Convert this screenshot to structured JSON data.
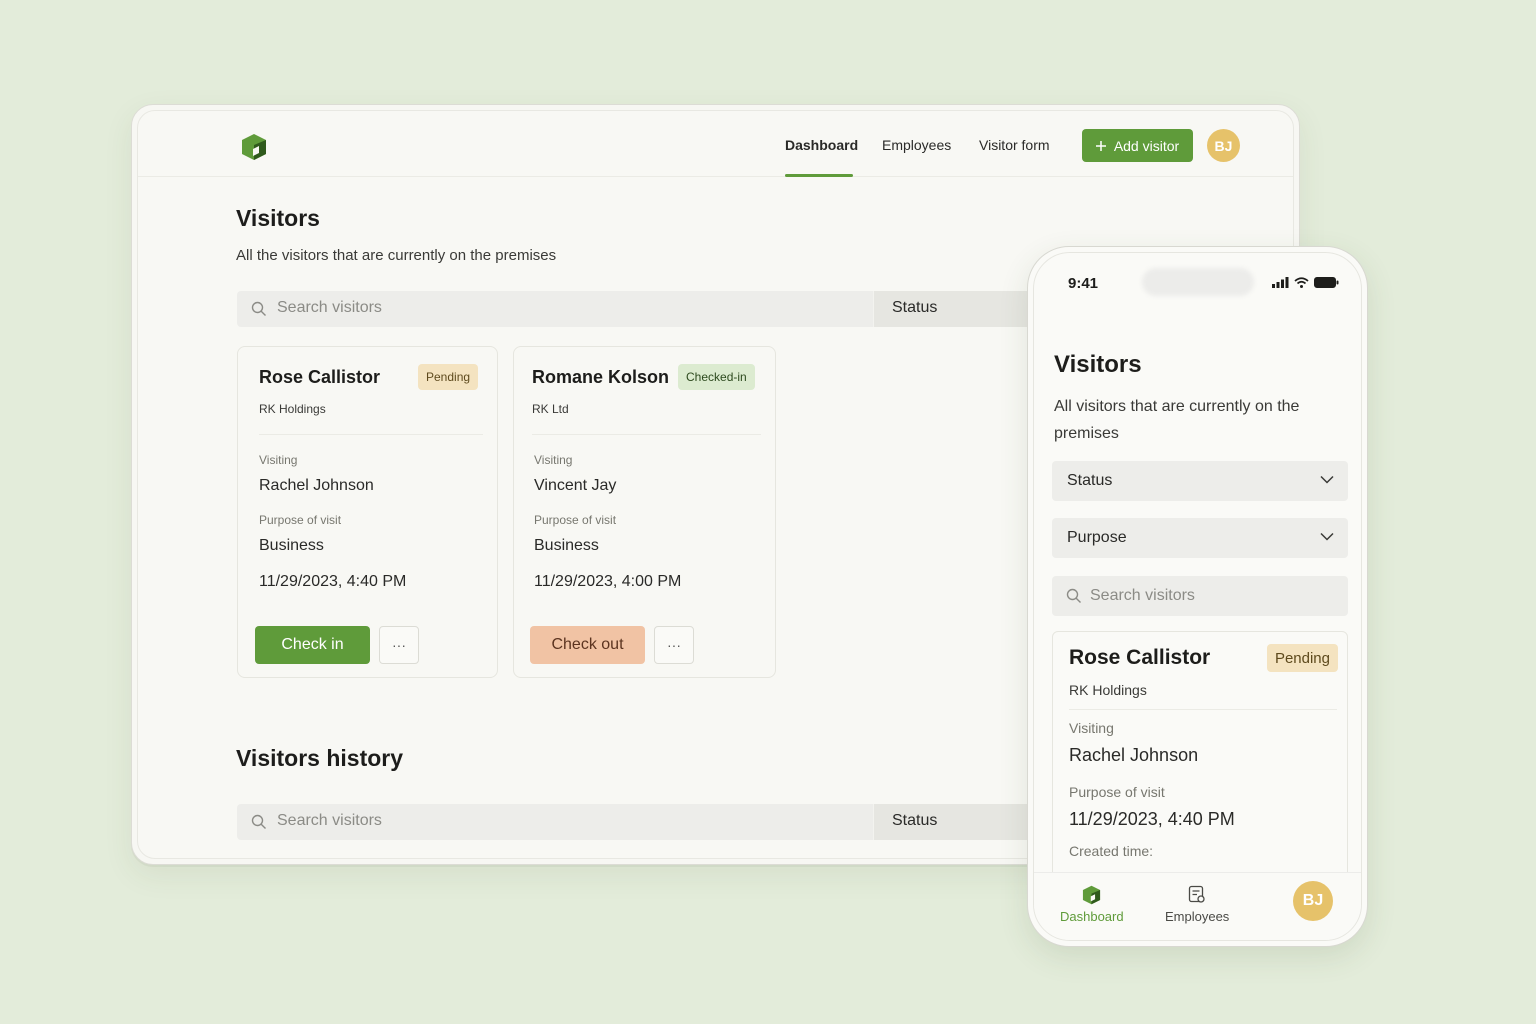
{
  "desktop": {
    "nav": {
      "dashboard": "Dashboard",
      "employees": "Employees",
      "visitor_form": "Visitor form",
      "add_visitor": "Add visitor",
      "avatar_initials": "BJ"
    },
    "title": "Visitors",
    "subtitle": "All the visitors that are currently on the premises",
    "search_placeholder": "Search visitors",
    "status_label": "Status",
    "cards": [
      {
        "name": "Rose Callistor",
        "status": "Pending",
        "company": "RK Holdings",
        "visiting_label": "Visiting",
        "visiting": "Rachel Johnson",
        "purpose_label": "Purpose of visit",
        "purpose": "Business",
        "datetime": "11/29/2023, 4:40 PM",
        "action": "Check in"
      },
      {
        "name": "Romane Kolson",
        "status": "Checked-in",
        "company": "RK Ltd",
        "visiting_label": "Visiting",
        "visiting": "Vincent Jay",
        "purpose_label": "Purpose of visit",
        "purpose": "Business",
        "datetime": "11/29/2023, 4:00 PM",
        "action": "Check out"
      }
    ],
    "more_label": "···",
    "history_title": "Visitors history",
    "history_search_placeholder": "Search visitors",
    "history_status_label": "Status"
  },
  "phone": {
    "time": "9:41",
    "title": "Visitors",
    "subtitle": "All visitors that are currently on the premises",
    "status_select": "Status",
    "purpose_select": "Purpose",
    "search_placeholder": "Search visitors",
    "card": {
      "name": "Rose Callistor",
      "status": "Pending",
      "company": "RK Holdings",
      "visiting_label": "Visiting",
      "visiting": "Rachel Johnson",
      "purpose_label": "Purpose of visit",
      "datetime": "11/29/2023, 4:40 PM",
      "created_label": "Created time:"
    },
    "tabs": {
      "dashboard": "Dashboard",
      "employees": "Employees",
      "avatar_initials": "BJ"
    }
  },
  "colors": {
    "background": "#e3ecda",
    "accent_green": "#5f9b3a",
    "pending_badge": "#f4e3c0",
    "checked_in_badge": "#dcebd0",
    "checkout_button": "#f1c3a4",
    "avatar": "#e6c26a"
  },
  "icons": [
    "logo-icon",
    "plus-icon",
    "search-icon",
    "more-icon",
    "chevron-down-icon",
    "signal-icon",
    "wifi-icon",
    "battery-icon",
    "dashboard-icon",
    "employees-icon"
  ]
}
